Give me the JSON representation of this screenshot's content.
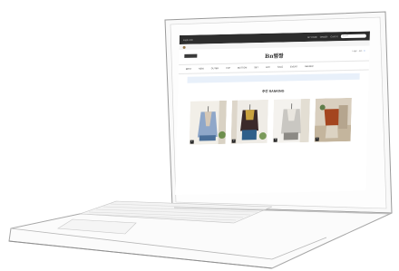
{
  "site": {
    "topbar_left": "Login  Join",
    "topbar_right": [
      "MY PAGE",
      "ORDER",
      "CART 0"
    ],
    "search_placeholder": "Search",
    "notice": "",
    "logo": "Bn뱀짱",
    "badge": "",
    "header_right": [
      "Login",
      "Join"
    ],
    "cart_label": "0",
    "nav": [
      "BEST",
      "NEW",
      "OUTER",
      "TOP",
      "BOTTOM",
      "SET",
      "ACC",
      "SALE",
      "EVENT",
      "REVIEW"
    ],
    "subline": "",
    "banner": {
      "tag": "",
      "text": "",
      "pill": ""
    },
    "ranking_title": "주간 RANKING"
  },
  "products": [
    {
      "rank": "1",
      "name": "",
      "price": "",
      "review": "",
      "palette": [
        "#8fa7c9",
        "#d6c8b6",
        "#4b6f99"
      ]
    },
    {
      "rank": "2",
      "name": "",
      "price": "",
      "review": "",
      "palette": [
        "#3b2a2a",
        "#c9a23f",
        "#2f5f8a"
      ]
    },
    {
      "rank": "3",
      "name": "",
      "price": "",
      "review": "",
      "palette": [
        "#c9c7c2",
        "#e9e6df",
        "#8c8a85"
      ]
    },
    {
      "rank": "4",
      "name": "",
      "price": "",
      "review": "",
      "palette": [
        "#a4451f",
        "#dcd3c3",
        "#b5a58e"
      ]
    }
  ],
  "colors": {
    "topbar": "#2d2d2d",
    "accent": "#2a6ad8",
    "banner": "#e8f0fa"
  }
}
